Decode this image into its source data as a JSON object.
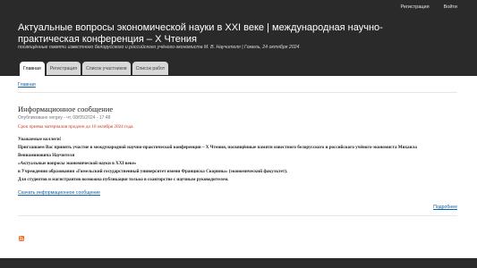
{
  "top_nav": {
    "register": "Регистрация",
    "login": "Войти"
  },
  "site": {
    "name": "Актуальные вопросы экономической науки в XXI веке | международная научно-практическая конференция – X Чтения",
    "slogan": "посвящённые памяти известного белорусского и российского учёного-экономиста М. В. Научителя | Гомель, 24 октября 2024"
  },
  "tabs": [
    {
      "label": "Главная"
    },
    {
      "label": "Регистрация"
    },
    {
      "label": "Список участников"
    },
    {
      "label": "Список работ"
    }
  ],
  "breadcrumb": "Главная",
  "node": {
    "title": "Информационное сообщение",
    "submitted": "Опубликовано vergey - чт, 08/05/2024 - 17:48",
    "deadline": "Срок приема материалов продлен до 10 октября 2024 года.",
    "body": [
      "Уважаемые коллеги!",
      "Приглашаем Вас принять участие в международной научно-практической конференции – X Чтения, посвящённые памяти известного белорусского и российского учёного-экономиста Михаила",
      "Вениаминовича Научителя",
      "«Актуальные вопросы экономической науки в XXI веке»",
      "в Учреждении образования «Гомельский государственный университет имени Франциска Скорины» (экономический факультет).",
      "Для студентов и магистрантов возможна публикация только в соавторстве с научным руководителем."
    ],
    "doc_link": "Скачать информационное сообщение",
    "read_more": "Подробнее"
  },
  "colors": {
    "header_bg": "#2a2a2a",
    "link": "#0a5fa8",
    "deadline": "#c8361d",
    "rss": "#f26522"
  }
}
